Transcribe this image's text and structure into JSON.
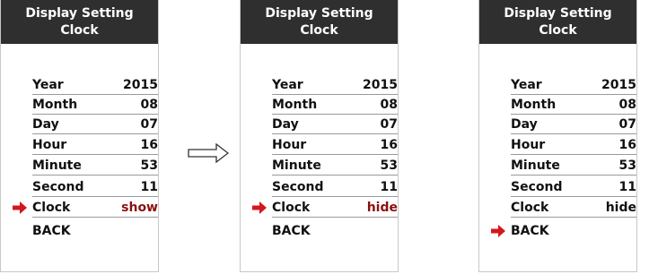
{
  "colors": {
    "header_bg": "#2f2f2f",
    "accent": "#8b1010",
    "arrow": "#d4171f"
  },
  "screens": [
    {
      "title_line1": "Display Setting",
      "title_line2": "Clock",
      "rows": [
        {
          "label": "Year",
          "value": "2015"
        },
        {
          "label": "Month",
          "value": "08"
        },
        {
          "label": "Day",
          "value": "07"
        },
        {
          "label": "Hour",
          "value": "16"
        },
        {
          "label": "Minute",
          "value": "53"
        },
        {
          "label": "Second",
          "value": "11"
        },
        {
          "label": "Clock",
          "value": "show"
        },
        {
          "label": "BACK",
          "value": ""
        }
      ],
      "selected": "Clock"
    },
    {
      "title_line1": "Display Setting",
      "title_line2": "Clock",
      "rows": [
        {
          "label": "Year",
          "value": "2015"
        },
        {
          "label": "Month",
          "value": "08"
        },
        {
          "label": "Day",
          "value": "07"
        },
        {
          "label": "Hour",
          "value": "16"
        },
        {
          "label": "Minute",
          "value": "53"
        },
        {
          "label": "Second",
          "value": "11"
        },
        {
          "label": "Clock",
          "value": "hide"
        },
        {
          "label": "BACK",
          "value": ""
        }
      ],
      "selected": "Clock"
    },
    {
      "title_line1": "Display Setting",
      "title_line2": "Clock",
      "rows": [
        {
          "label": "Year",
          "value": "2015"
        },
        {
          "label": "Month",
          "value": "08"
        },
        {
          "label": "Day",
          "value": "07"
        },
        {
          "label": "Hour",
          "value": "16"
        },
        {
          "label": "Minute",
          "value": "53"
        },
        {
          "label": "Second",
          "value": "11"
        },
        {
          "label": "Clock",
          "value": "hide"
        },
        {
          "label": "BACK",
          "value": ""
        }
      ],
      "selected": "BACK"
    }
  ],
  "transition_icon": "right-outline-arrow-icon"
}
